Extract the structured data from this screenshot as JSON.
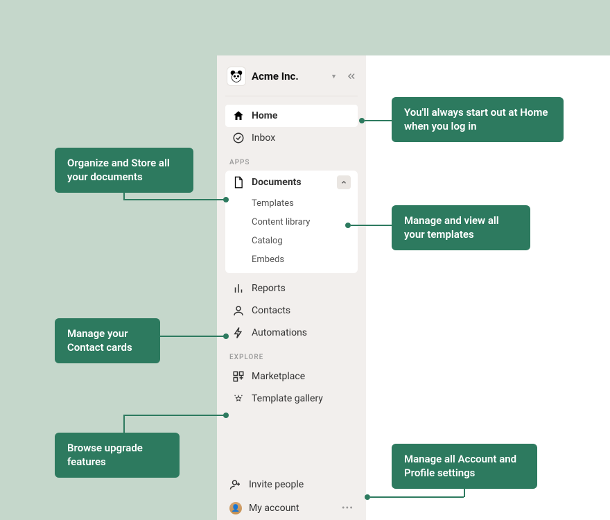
{
  "workspace": {
    "name": "Acme Inc."
  },
  "sidebar": {
    "main": [
      {
        "label": "Home",
        "icon": "home-icon",
        "active": true
      },
      {
        "label": "Inbox",
        "icon": "inbox-icon"
      }
    ],
    "apps_label": "APPS",
    "documents": {
      "label": "Documents",
      "items": [
        "Templates",
        "Content library",
        "Catalog",
        "Embeds"
      ]
    },
    "apps_rest": [
      {
        "label": "Reports",
        "icon": "reports-icon"
      },
      {
        "label": "Contacts",
        "icon": "contacts-icon"
      },
      {
        "label": "Automations",
        "icon": "automations-icon"
      }
    ],
    "explore_label": "EXPLORE",
    "explore": [
      {
        "label": "Marketplace",
        "icon": "marketplace-icon"
      },
      {
        "label": "Template gallery",
        "icon": "gallery-icon"
      }
    ],
    "bottom": {
      "invite_label": "Invite people",
      "account_label": "My account"
    }
  },
  "callouts": {
    "c1": "You'll always start out at Home when you log in",
    "c2": "Organize and Store all your documents",
    "c3": "Manage and view all your templates",
    "c4": "Manage your Contact cards",
    "c5": "Browse upgrade features",
    "c6": "Manage all Account and Profile settings"
  }
}
